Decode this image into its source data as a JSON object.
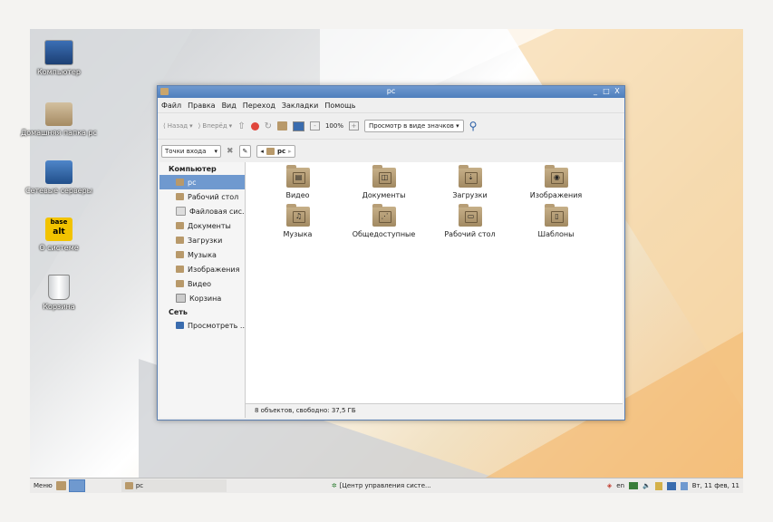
{
  "desktop": {
    "icons": [
      {
        "label": "Компьютер"
      },
      {
        "label": "Домашняя папка pc"
      },
      {
        "label": "Сетевые серверы"
      },
      {
        "label": "О системе",
        "logo_top": "base",
        "logo_bottom": "alt"
      },
      {
        "label": "Корзина"
      }
    ]
  },
  "window": {
    "title": "pc",
    "controls": [
      "_",
      "□",
      "X"
    ],
    "menu": [
      "Файл",
      "Правка",
      "Вид",
      "Переход",
      "Закладки",
      "Помощь"
    ],
    "toolbar": {
      "back": "Назад",
      "forward": "Вперёд",
      "zoom": "100%",
      "view_mode": "Просмотр в виде значков"
    },
    "location": {
      "side_pane_mode": "Точки входа",
      "path_current": "pc"
    },
    "sidebar": {
      "sections": [
        {
          "header": "Компьютер",
          "items": [
            "pc",
            "Рабочий стол",
            "Файловая сис...",
            "Документы",
            "Загрузки",
            "Музыка",
            "Изображения",
            "Видео",
            "Корзина"
          ]
        },
        {
          "header": "Сеть",
          "items": [
            "Просмотреть ..."
          ]
        }
      ],
      "selected": "pc"
    },
    "files": [
      {
        "name": "Видео",
        "glyph": "▤"
      },
      {
        "name": "Документы",
        "glyph": "◫"
      },
      {
        "name": "Загрузки",
        "glyph": "⇣"
      },
      {
        "name": "Изображения",
        "glyph": "◉"
      },
      {
        "name": "Музыка",
        "glyph": "♫"
      },
      {
        "name": "Общедоступные",
        "glyph": "⋰"
      },
      {
        "name": "Рабочий стол",
        "glyph": "▭"
      },
      {
        "name": "Шаблоны",
        "glyph": "▯"
      }
    ],
    "status": "8 объектов, свободно: 37,5 ГБ"
  },
  "taskbar": {
    "menu": "Меню",
    "task_window": "pc",
    "task_other": "[Центр управления систе...",
    "lang": "en",
    "clock": "Вт, 11 фев, 11"
  },
  "colors": {
    "accent": "#6f99cf",
    "folder": "#b8996a"
  }
}
